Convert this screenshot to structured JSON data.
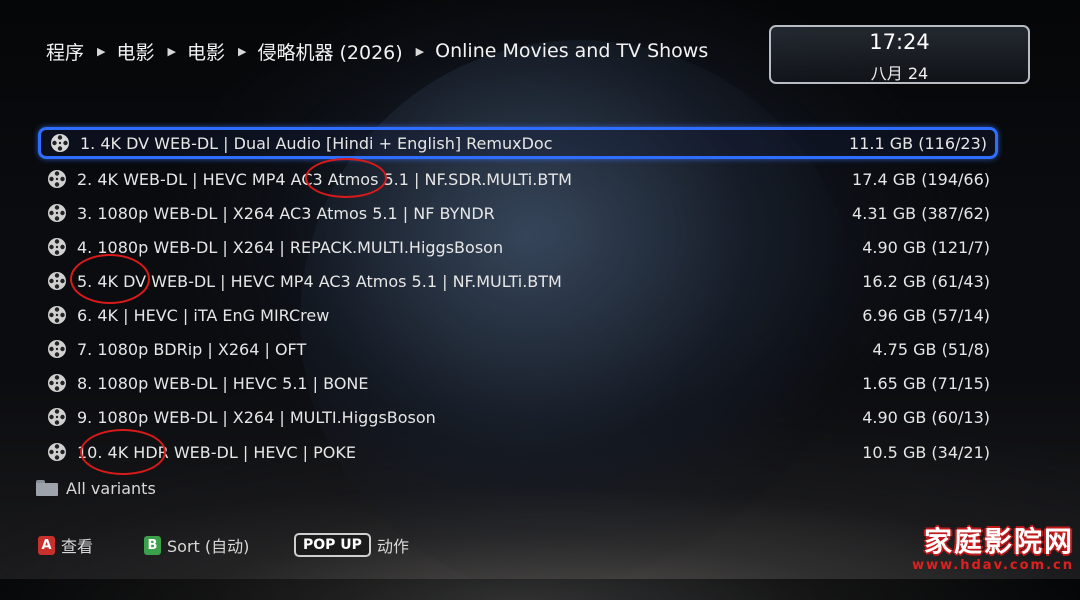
{
  "breadcrumb": [
    "程序",
    "电影",
    "电影",
    "侵略机器 (2026)",
    "Online Movies and TV Shows"
  ],
  "clock": {
    "time": "17:24",
    "date": "八月 24"
  },
  "variants": [
    {
      "title": "1. 4K DV WEB-DL | Dual Audio [Hindi + English] RemuxDoc",
      "size": "11.1 GB (116/23)",
      "selected": true
    },
    {
      "title": "2. 4K WEB-DL | HEVC MP4 AC3 Atmos 5.1 | NF.SDR.MULTi.BTM",
      "size": "17.4 GB (194/66)"
    },
    {
      "title": "3. 1080p WEB-DL | X264 AC3 Atmos 5.1 | NF BYNDR",
      "size": "4.31 GB (387/62)"
    },
    {
      "title": "4. 1080p WEB-DL | X264 | REPACK.MULTI.HiggsBoson",
      "size": "4.90 GB (121/7)"
    },
    {
      "title": "5. 4K DV WEB-DL | HEVC MP4 AC3 Atmos 5.1 | NF.MULTi.BTM",
      "size": "16.2 GB (61/43)"
    },
    {
      "title": "6. 4K | HEVC | iTA EnG MIRCrew",
      "size": "6.96 GB (57/14)"
    },
    {
      "title": "7. 1080p BDRip | X264 | OFT",
      "size": "4.75 GB (51/8)"
    },
    {
      "title": "8. 1080p WEB-DL | HEVC 5.1 | BONE",
      "size": "1.65 GB (71/15)"
    },
    {
      "title": "9. 1080p WEB-DL | X264 | MULTI.HiggsBoson",
      "size": "4.90 GB (60/13)"
    },
    {
      "title": "10. 4K HDR WEB-DL | HEVC | POKE",
      "size": "10.5 GB (34/21)"
    }
  ],
  "all_variants_label": "All variants",
  "footer": {
    "a_key": "A",
    "a_label": "查看",
    "b_key": "B",
    "b_label": "Sort (自动)",
    "popup_key": "POP UP",
    "popup_label": "动作"
  },
  "watermark": {
    "name": "家庭影院网",
    "url": "www.hdav.com.cn"
  },
  "colors": {
    "selection": "#2f6dff",
    "annotation": "#d81a1a",
    "key_a": "#c9302c",
    "key_b": "#3aa14a"
  },
  "icons": {
    "row": "film-reel-icon",
    "all_variants": "folder-icon"
  }
}
